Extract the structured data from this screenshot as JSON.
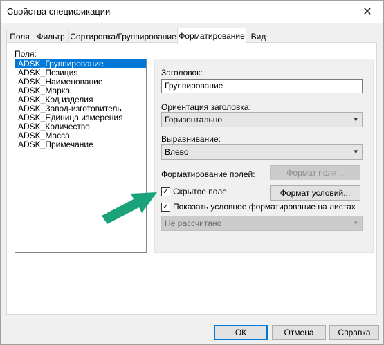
{
  "window": {
    "title": "Свойства спецификации",
    "close_glyph": "✕"
  },
  "tabs": [
    {
      "label": "Поля"
    },
    {
      "label": "Фильтр"
    },
    {
      "label": "Сортировка/Группирование"
    },
    {
      "label": "Форматирование",
      "active": true
    },
    {
      "label": "Вид"
    }
  ],
  "fields": {
    "label": "Поля:",
    "items": [
      "ADSK_Группирование",
      "ADSK_Позиция",
      "ADSK_Наименование",
      "ADSK_Марка",
      "ADSK_Код изделия",
      "ADSK_Завод-изготовитель",
      "ADSK_Единица измерения",
      "ADSK_Количество",
      "ADSK_Масса",
      "ADSK_Примечание"
    ],
    "selected_index": 0
  },
  "format": {
    "heading_label": "Заголовок:",
    "heading_value": "Группирование",
    "orientation_label": "Ориентация заголовка:",
    "orientation_value": "Горизонтально",
    "alignment_label": "Выравнивание:",
    "alignment_value": "Влево",
    "field_format_label": "Форматирование полей:",
    "field_format_button": "Формат поля...",
    "hidden_field_label": "Скрытое поле",
    "hidden_field_checked": true,
    "conditional_format_button": "Формат условий...",
    "show_conditional_label": "Показать условное форматирование на листах",
    "show_conditional_checked": true,
    "calc_value": "Не рассчитано"
  },
  "footer": {
    "ok": "ОК",
    "cancel": "Отмена",
    "help": "Справка"
  },
  "colors": {
    "selection": "#0078d7",
    "annotation_arrow": "#1aa37a"
  },
  "icons": {
    "dropdown": "▾",
    "check": "✓",
    "close": "close-icon"
  }
}
